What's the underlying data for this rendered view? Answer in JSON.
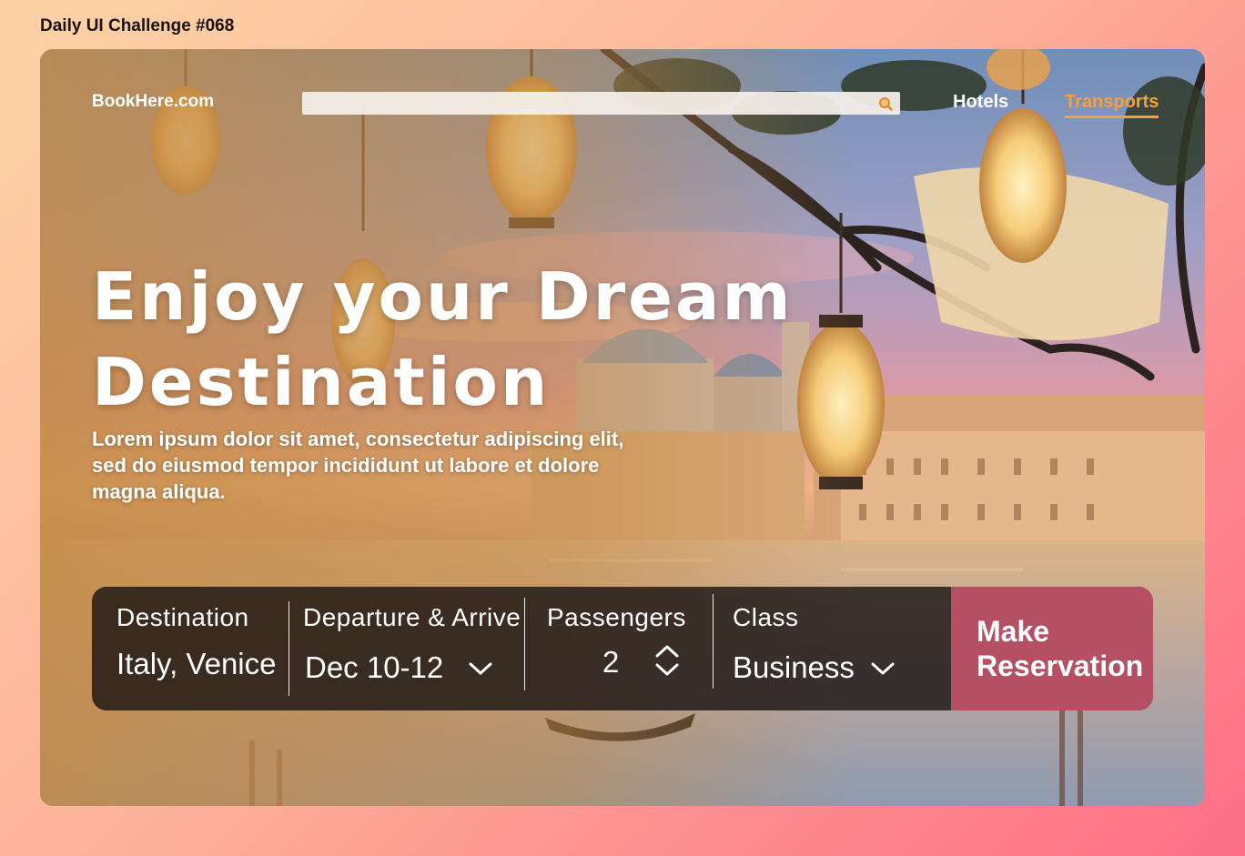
{
  "page": {
    "title": "Daily UI Challenge #068"
  },
  "header": {
    "logo": "BookHere.com",
    "search": {
      "placeholder": "",
      "value": ""
    },
    "nav": [
      {
        "label": "Hotels",
        "active": false
      },
      {
        "label": "Transports",
        "active": true
      }
    ]
  },
  "hero": {
    "title_line1": "Enjoy your Dream",
    "title_line2": "Destination",
    "subtitle_line1": "Lorem ipsum dolor sit amet, consectetur adipiscing elit,",
    "subtitle_line2": "sed do eiusmod tempor incididunt ut labore et dolore",
    "subtitle_line3": "magna aliqua."
  },
  "booking": {
    "destination": {
      "label": "Destination",
      "value": "Italy, Venice"
    },
    "dates": {
      "label": "Departure & Arrive",
      "value": "Dec 10-12"
    },
    "passengers": {
      "label": "Passengers",
      "value": "2"
    },
    "class": {
      "label": "Class",
      "value": "Business"
    },
    "reserve_line1": "Make",
    "reserve_line2": "Reservation"
  },
  "colors": {
    "accent": "#f7a03a",
    "reserve_button": "#b55064",
    "booking_bar": "#161111",
    "background_start": "#fdd3a6",
    "background_end": "#fe6f86"
  },
  "icons": {
    "search": "search-icon",
    "date_dropdown": "chevron-down-icon",
    "class_dropdown": "chevron-down-icon",
    "passenger_stepper": "up-down-stepper-icon"
  }
}
